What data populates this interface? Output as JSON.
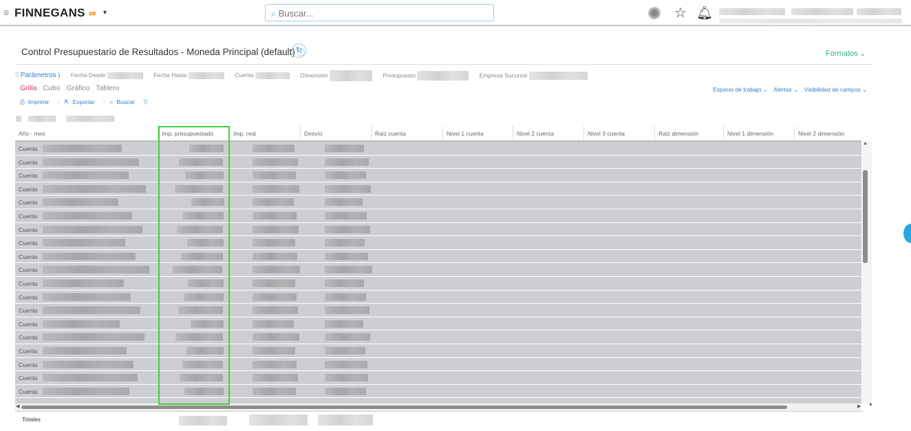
{
  "header": {
    "logo_text": "FINNEGANS",
    "logo_mark": "∞",
    "logo_caret": "▾",
    "search_placeholder": "Buscar...",
    "icons": [
      "menu-icon",
      "search-icon",
      "app-icon",
      "star-icon",
      "bell-icon"
    ]
  },
  "report": {
    "title": "Control Presupuestario de Resultados - Moneda Principal (default)",
    "info_glyph": "ⓘ",
    "refresh_glyph": "↻",
    "formatos_label": "Formatos ⌄"
  },
  "params": {
    "label": "Parámetros",
    "arrow": "⟩",
    "fields": [
      "Fecha Desde",
      "Fecha Hasta",
      "Cuenta",
      "Dimensión",
      "Presupuesto",
      "Empresa Sucursal"
    ]
  },
  "view_tabs": [
    {
      "label": "Grilla",
      "active": true
    },
    {
      "label": "Cubo",
      "active": false
    },
    {
      "label": "Gráfico",
      "active": false
    },
    {
      "label": "Tablero",
      "active": false
    }
  ],
  "right_links": [
    "Espacio de trabajo ⌄",
    "Alertas ⌄",
    "Visibilidad de campos ⌄"
  ],
  "actions": {
    "print": "Imprimir",
    "export": "Exportar",
    "search": "Buscar",
    "filter_glyph": "▽"
  },
  "grid": {
    "columns": [
      "Año - mes",
      "Imp. presupuestado",
      "Imp. real",
      "Desvío",
      "Raiz cuenta",
      "Nivel 1 cuenta",
      "Nivel 2 cuenta",
      "Nivel 3 cuenta",
      "Raiz dimensión",
      "Nivel 1 dimensión",
      "Nivel 2 dimensión"
    ],
    "row_label": "Cuenta",
    "visible_row_count": 19,
    "totals_label": "Totales"
  },
  "colors": {
    "accent_blue": "#2f7fd0",
    "active_tab": "#e0305a",
    "formatos_green": "#2db57b",
    "highlight_green": "#3ed13e",
    "row_bg": "#cdced2"
  }
}
